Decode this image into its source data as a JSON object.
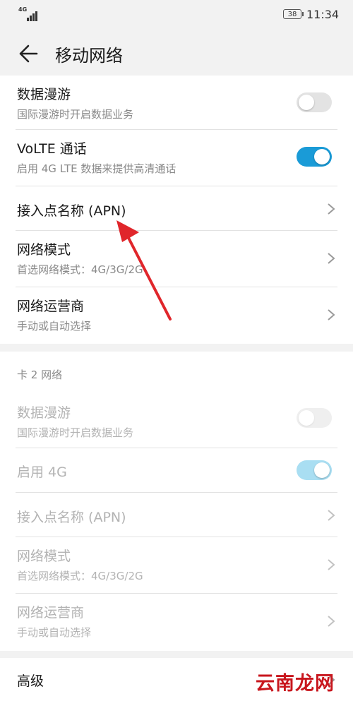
{
  "status_bar": {
    "signal_label": "4G",
    "battery": "38",
    "time": "11:34"
  },
  "app_bar": {
    "title": "移动网络",
    "back_icon": "arrow-left-icon"
  },
  "sim1": [
    {
      "title": "数据漫游",
      "subtitle": "国际漫游时开启数据业务",
      "control": "toggle",
      "toggle_on": false
    },
    {
      "title": "VoLTE 通话",
      "subtitle": "启用 4G LTE 数据来提供高清通话",
      "control": "toggle",
      "toggle_on": true
    },
    {
      "title": "接入点名称 (APN)",
      "control": "chevron"
    },
    {
      "title": "网络模式",
      "subtitle": "首选网络模式：4G/3G/2G",
      "control": "chevron"
    },
    {
      "title": "网络运营商",
      "subtitle": "手动或自动选择",
      "control": "chevron"
    }
  ],
  "sim2_label": "卡 2 网络",
  "sim2": [
    {
      "title": "数据漫游",
      "subtitle": "国际漫游时开启数据业务",
      "control": "toggle",
      "toggle_on": false,
      "disabled": true
    },
    {
      "title": "启用 4G",
      "control": "toggle",
      "toggle_on": true,
      "disabled": true
    },
    {
      "title": "接入点名称 (APN)",
      "control": "chevron",
      "disabled": true
    },
    {
      "title": "网络模式",
      "subtitle": "首选网络模式：4G/3G/2G",
      "control": "chevron",
      "disabled": true
    },
    {
      "title": "网络运营商",
      "subtitle": "手动或自动选择",
      "control": "chevron",
      "disabled": true
    }
  ],
  "advanced": {
    "title": "高级"
  },
  "watermark": "云南龙网",
  "colors": {
    "accent": "#1a9bd7",
    "annotation_arrow": "#e0262b"
  }
}
